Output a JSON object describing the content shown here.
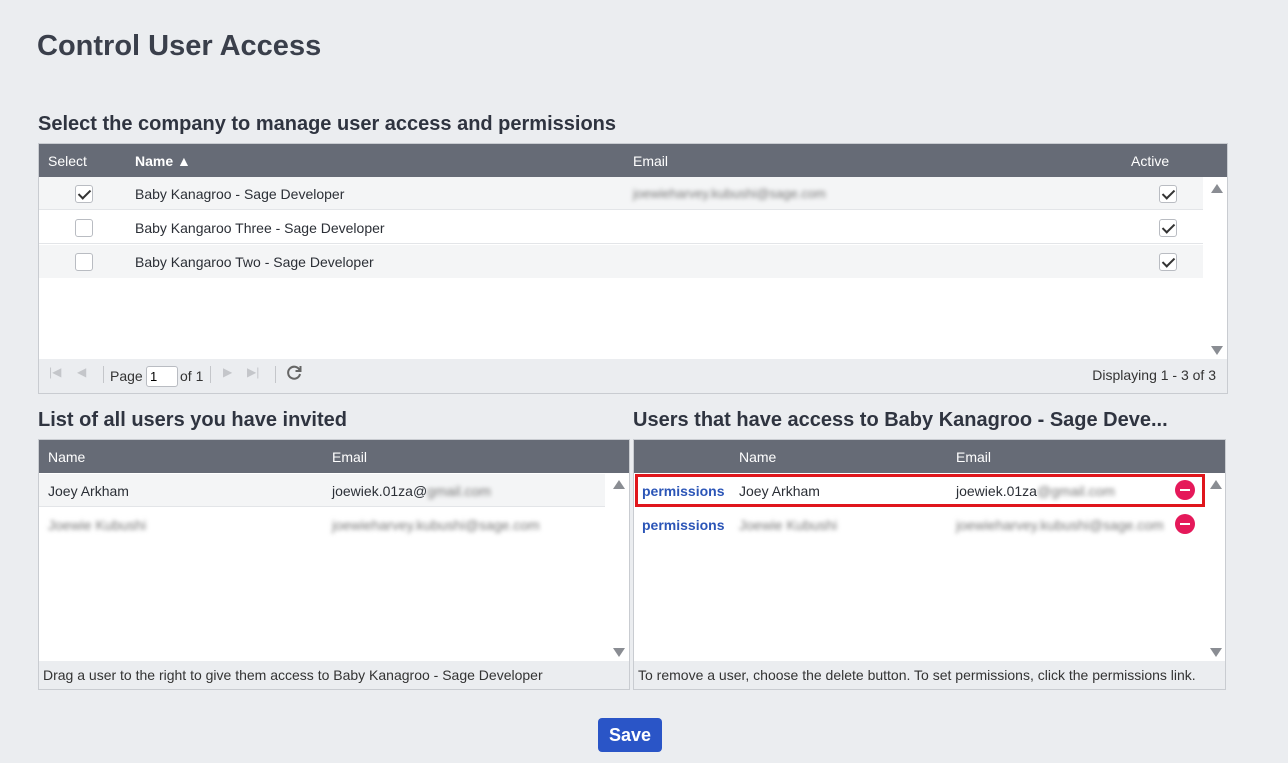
{
  "page_title": "Control User Access",
  "companies": {
    "section_title": "Select the company to manage user access and permissions",
    "headers": {
      "select": "Select",
      "name": "Name ▲",
      "email": "Email",
      "active": "Active"
    },
    "rows": [
      {
        "selected": true,
        "name": "Baby Kanagroo - Sage Developer",
        "email": "joewieharvey.kubushi@sage.com",
        "active": true
      },
      {
        "selected": false,
        "name": "Baby Kangaroo Three - Sage Developer",
        "email": "",
        "active": true
      },
      {
        "selected": false,
        "name": "Baby Kangaroo Two - Sage Developer",
        "email": "",
        "active": true
      }
    ],
    "pager": {
      "page_label": "Page",
      "page_value": "1",
      "of_label": "of 1",
      "displaying": "Displaying 1 - 3 of 3"
    }
  },
  "invited": {
    "section_title": "List of all users you have invited",
    "headers": {
      "name": "Name",
      "email": "Email"
    },
    "rows": [
      {
        "name": "Joey Arkham",
        "email_visible": "joewiek.01za@",
        "email_blurred": "gmail.com"
      },
      {
        "name": "Joewie Kubushi",
        "email_visible": "",
        "email_blurred": "joewieharvey.kubushi@sage.com"
      }
    ],
    "footer": "Drag a user to the right to give them access to Baby Kanagroo - Sage Developer"
  },
  "access": {
    "section_title": "Users that have access to Baby Kanagroo - Sage Deve...",
    "headers": {
      "name": "Name",
      "email": "Email"
    },
    "rows": [
      {
        "link": "permissions",
        "name": "Joey Arkham",
        "email_visible": "joewiek.01za",
        "email_blurred": "@gmail.com"
      },
      {
        "link": "permissions",
        "name": "Joewie Kubushi",
        "email_visible": "",
        "email_blurred": "joewieharvey.kubushi@sage.com"
      }
    ],
    "footer": "To remove a user, choose the delete button. To set permissions, click the permissions link."
  },
  "save_label": "Save"
}
